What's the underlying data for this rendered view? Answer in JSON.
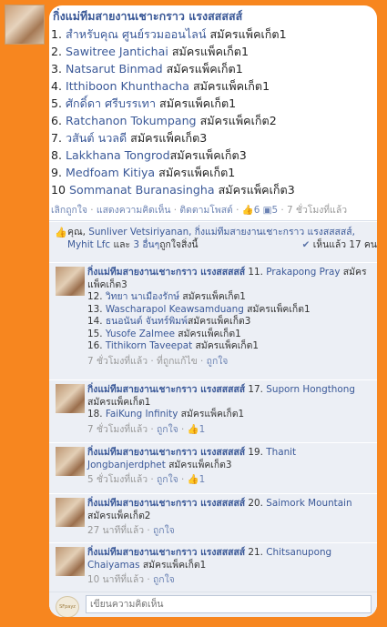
{
  "post": {
    "author_title": "กิ่งแม่ทีมสายงานเชาะกราว แรงสสสสส์",
    "entries": [
      {
        "prefix": "1. ",
        "name": "สำหรับคุณ ศูนย์รวมออนไลน์",
        "suffix": " สมัครแพ็คเก็ต1"
      },
      {
        "prefix": "2. ",
        "name": "Sawitree Jantichai",
        "suffix": " สมัครแพ็คเก็ต1"
      },
      {
        "prefix": "3. ",
        "name": "Natsarut Binmad",
        "suffix": " สมัครแพ็คเก็ต1"
      },
      {
        "prefix": "4. ",
        "name": "Itthiboon Khunthacha",
        "suffix": " สมัครแพ็คเก็ต1"
      },
      {
        "prefix": "5. ",
        "name": "ศักดิ์ดา ศรีบรรเทา",
        "suffix": " สมัครแพ็คเก็ต1"
      },
      {
        "prefix": "6. ",
        "name": "Ratchanon Tokumpang",
        "suffix": " สมัครแพ็คเก็ต2"
      },
      {
        "prefix": "7. ",
        "name": "วสันต์ นวลดี",
        "suffix": " สมัครแพ็คเก็ต3"
      },
      {
        "prefix": "8. ",
        "name": "Lakkhana Tongrod",
        "suffix": "สมัครแพ็คเก็ต3"
      },
      {
        "prefix": "9. ",
        "name": "Medfoam Kitiya",
        "suffix": " สมัครแพ็คเก็ต1"
      },
      {
        "prefix": "10 ",
        "name": "Sommanat Buranasingha",
        "suffix": " สมัครแพ็คเก็ต3"
      }
    ],
    "actions": {
      "unlike": "เลิกถูกใจ",
      "comment": "แสดงความคิดเห็น",
      "follow": "ติดตามโพสต์",
      "sep": " · ",
      "like_count": "6",
      "comment_count": "5",
      "time": "7 ชั่วโมงที่แล้ว"
    },
    "likes": {
      "you": "คุณ,",
      "names": "Sunliver Vetsiriyanan, กิ่งแม่ทีมสายงานเชาะกราว แรงสสสสส์, Myhit Lfc",
      "and_others": "และ",
      "others_link": "3 อื่นๆ",
      "like_this": "ถูกใจสิ่งนี้",
      "seen": "เห็นแล้ว 17 คน"
    }
  },
  "comments": [
    {
      "author": "กิ่งแม่ทีมสายงานเชาะกราว แรงสสสสส์",
      "lines": [
        {
          "prefix": " 11. ",
          "name": "Prakapong Pray",
          "suffix": " สมัครแพ็คเก็ต3"
        },
        {
          "prefix": "12. ",
          "name": "วิทยา นาเมืองรักษ์",
          "suffix": " สมัครแพ็คเก็ต1"
        },
        {
          "prefix": "13. ",
          "name": "Wascharapol Keawsamduang",
          "suffix": " สมัครแพ็คเก็ต1"
        },
        {
          "prefix": "14. ",
          "name": "ธนอนันต์ จันทร์พิมพ์",
          "suffix": "สมัครแพ็คเก็ต3"
        },
        {
          "prefix": "15. ",
          "name": "Yusofe Zalmee",
          "suffix": " สมัครแพ็คเก็ต1"
        },
        {
          "prefix": "16. ",
          "name": "Tithikorn Taveepat",
          "suffix": " สมัครแพ็คเก็ต1"
        }
      ],
      "time": "7 ชั่วโมงที่แล้ว",
      "extra": "ที่ถูกแก้ไข",
      "like": "ถูกใจ",
      "likes": ""
    },
    {
      "author": "กิ่งแม่ทีมสายงานเชาะกราว แรงสสสสส์",
      "lines": [
        {
          "prefix": " 17. ",
          "name": "Suporn Hongthong",
          "suffix": " สมัครแพ็คเก็ต1"
        },
        {
          "prefix": "18. ",
          "name": "FaiKung Infinity",
          "suffix": " สมัครแพ็คเก็ต1"
        }
      ],
      "time": "7 ชั่วโมงที่แล้ว",
      "extra": "",
      "like": "ถูกใจ",
      "likes": "1"
    },
    {
      "author": "กิ่งแม่ทีมสายงานเชาะกราว แรงสสสสส์",
      "lines": [
        {
          "prefix": " 19. ",
          "name": "Thanit Jongbanjerdphet",
          "suffix": " สมัครแพ็คเก็ต3"
        }
      ],
      "time": "5 ชั่วโมงที่แล้ว",
      "extra": "",
      "like": "ถูกใจ",
      "likes": "1"
    },
    {
      "author": "กิ่งแม่ทีมสายงานเชาะกราว แรงสสสสส์",
      "lines": [
        {
          "prefix": " 20. ",
          "name": "Saimork Mountain",
          "suffix": " สมัครแพ็คเก็ต2"
        }
      ],
      "time": "27 นาทีที่แล้ว",
      "extra": "",
      "like": "ถูกใจ",
      "likes": ""
    },
    {
      "author": "กิ่งแม่ทีมสายงานเชาะกราว แรงสสสสส์",
      "lines": [
        {
          "prefix": " 21. ",
          "name": "Chitsanupong Chaiyamas",
          "suffix": " สมัครแพ็คเก็ต1"
        }
      ],
      "time": "10 นาทีที่แล้ว",
      "extra": "",
      "like": "ถูกใจ",
      "likes": ""
    }
  ],
  "composer": {
    "placeholder": "เขียนความคิดเห็น",
    "avatar_label": "SFpayz"
  },
  "colors": {
    "background": "#f7861f",
    "link": "#3b5998",
    "panel": "#eceff5"
  },
  "icons": {
    "like": "thumbs-up-icon",
    "comment": "speech-bubble-icon",
    "seen": "check-icon"
  }
}
